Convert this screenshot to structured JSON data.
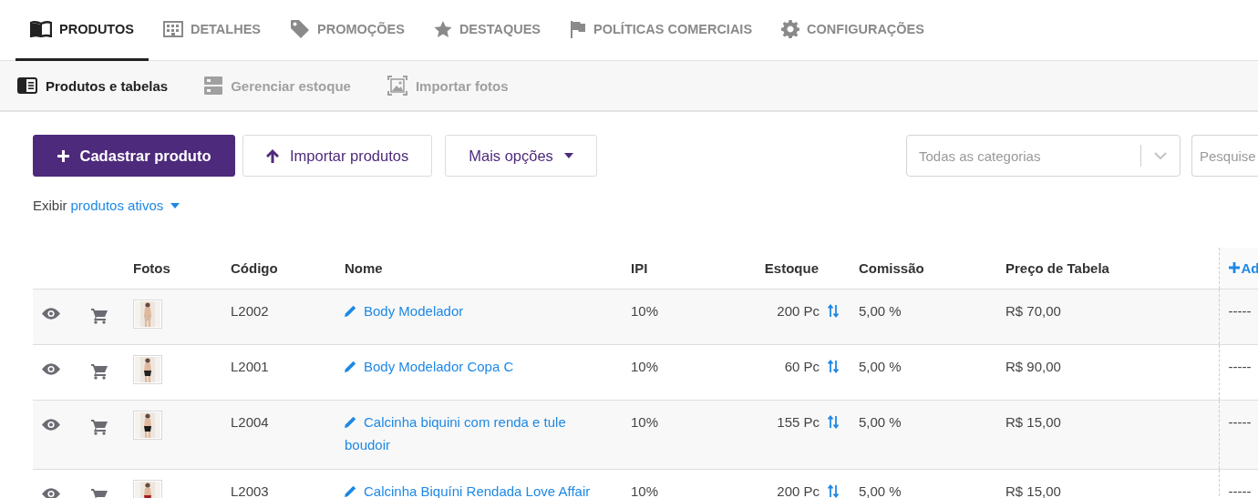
{
  "tabs": [
    {
      "label": "PRODUTOS",
      "selected": true
    },
    {
      "label": "DETALHES",
      "selected": false
    },
    {
      "label": "PROMOÇÕES",
      "selected": false
    },
    {
      "label": "DESTAQUES",
      "selected": false
    },
    {
      "label": "POLÍTICAS COMERCIAIS",
      "selected": false
    },
    {
      "label": "CONFIGURAÇÕES",
      "selected": false
    }
  ],
  "subtabs": [
    {
      "label": "Produtos e tabelas",
      "selected": true
    },
    {
      "label": "Gerenciar estoque",
      "selected": false
    },
    {
      "label": "Importar fotos",
      "selected": false
    }
  ],
  "actions": {
    "primary": "Cadastrar produto",
    "import": "Importar produtos",
    "more": "Mais opções"
  },
  "category_select": {
    "placeholder": "Todas as categorias"
  },
  "search": {
    "placeholder": "Pesquise"
  },
  "filter": {
    "prefix": "Exibir",
    "value": "produtos ativos"
  },
  "table": {
    "columns": [
      "Fotos",
      "Código",
      "Nome",
      "IPI",
      "Estoque",
      "Comissão",
      "Preço de Tabela",
      "Ad"
    ],
    "rows": [
      {
        "code": "L2002",
        "name": "Body Modelador",
        "ipi": "10%",
        "stock": "200 Pc",
        "commission": "5,00 %",
        "price": "R$ 70,00",
        "extra": "-----"
      },
      {
        "code": "L2001",
        "name": "Body Modelador Copa C",
        "ipi": "10%",
        "stock": "60 Pc",
        "commission": "5,00 %",
        "price": "R$ 90,00",
        "extra": "-----"
      },
      {
        "code": "L2004",
        "name": "Calcinha biquini com renda e tule boudoir",
        "ipi": "10%",
        "stock": "155 Pc",
        "commission": "5,00 %",
        "price": "R$ 15,00",
        "extra": "-----"
      },
      {
        "code": "L2003",
        "name": "Calcinha Biquíni Rendada Love Affair",
        "ipi": "10%",
        "stock": "200 Pc",
        "commission": "5,00 %",
        "price": "R$ 15,00",
        "extra": "-----"
      }
    ]
  }
}
